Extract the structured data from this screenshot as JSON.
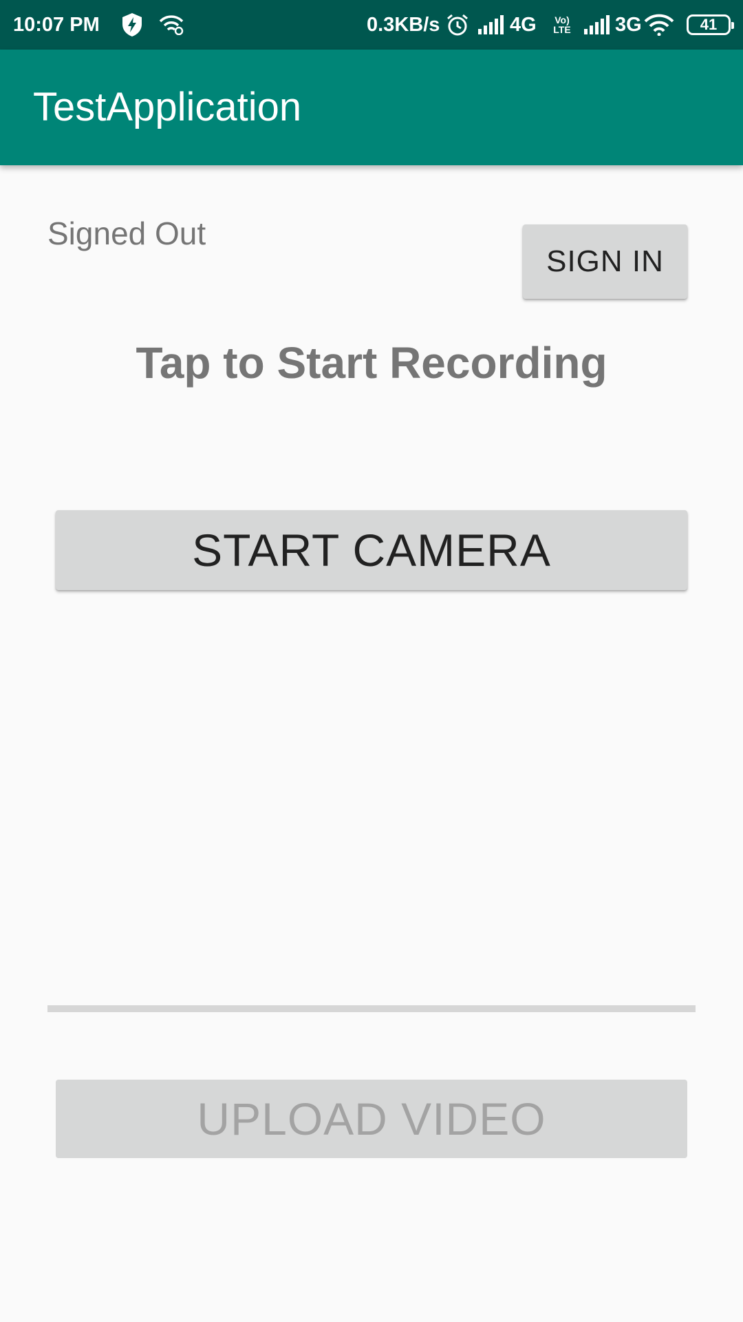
{
  "status_bar": {
    "time": "10:07 PM",
    "network_speed": "0.3KB/s",
    "network_4g": "4G",
    "volte": "Vo) LTE",
    "network_3g": "3G",
    "battery": "41",
    "icons": [
      "shield-bolt-icon",
      "wifi-share-icon",
      "alarm-icon",
      "signal-icon",
      "signal-icon",
      "wifi-icon",
      "battery-icon"
    ]
  },
  "app_bar": {
    "title": "TestApplication"
  },
  "main": {
    "auth_status": "Signed Out",
    "sign_in_label": "SIGN IN",
    "headline": "Tap to Start Recording",
    "start_camera_label": "START CAMERA",
    "upload_progress": 0,
    "upload_label": "UPLOAD VIDEO"
  },
  "colors": {
    "status_bar": "#00574f",
    "app_bar": "#008577",
    "background": "#fafafa",
    "button": "#d6d7d7",
    "text_secondary": "#757575"
  }
}
